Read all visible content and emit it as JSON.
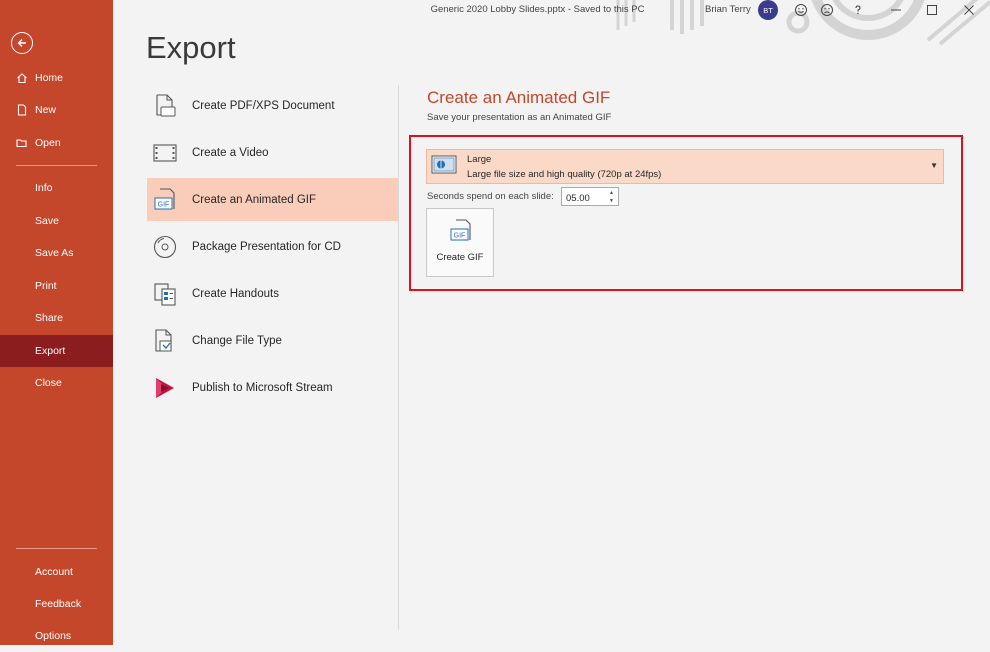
{
  "window": {
    "title": "Generic 2020 Lobby Slides.pptx  -  Saved to this PC",
    "user_name": "Brian Terry",
    "user_initials": "BT"
  },
  "nav": {
    "top_items": [
      {
        "label": "Home",
        "icon": "home-icon"
      },
      {
        "label": "New",
        "icon": "new-document-icon"
      },
      {
        "label": "Open",
        "icon": "folder-open-icon"
      }
    ],
    "middle_items": [
      "Info",
      "Save",
      "Save As",
      "Print",
      "Share",
      "Export",
      "Close"
    ],
    "active": "Export",
    "bottom_items": [
      "Account",
      "Feedback",
      "Options"
    ]
  },
  "export": {
    "title": "Export",
    "options": [
      {
        "label": "Create PDF/XPS Document",
        "icon": "pdf-document-icon"
      },
      {
        "label": "Create a Video",
        "icon": "video-icon"
      },
      {
        "label": "Create an Animated GIF",
        "icon": "gif-icon",
        "selected": true
      },
      {
        "label": "Package Presentation for CD",
        "icon": "cd-icon"
      },
      {
        "label": "Create Handouts",
        "icon": "handouts-icon"
      },
      {
        "label": "Change File Type",
        "icon": "change-file-type-icon"
      },
      {
        "label": "Publish to Microsoft Stream",
        "icon": "stream-icon"
      }
    ]
  },
  "gif_pane": {
    "title": "Create an Animated GIF",
    "description": "Save your presentation as an Animated GIF",
    "quality": {
      "name": "Large",
      "description": "Large file size and high quality (720p at 24fps)"
    },
    "seconds_label": "Seconds spend on each slide:",
    "seconds_value": "05.00",
    "create_button_label": "Create GIF",
    "gif_icon_text": "GIF"
  },
  "colors": {
    "nav_bg": "#c4472b",
    "nav_active": "#8c1d1f",
    "accent": "#c4472b",
    "selected_option": "#f9cdb9",
    "highlight_box": "#e0101b"
  }
}
